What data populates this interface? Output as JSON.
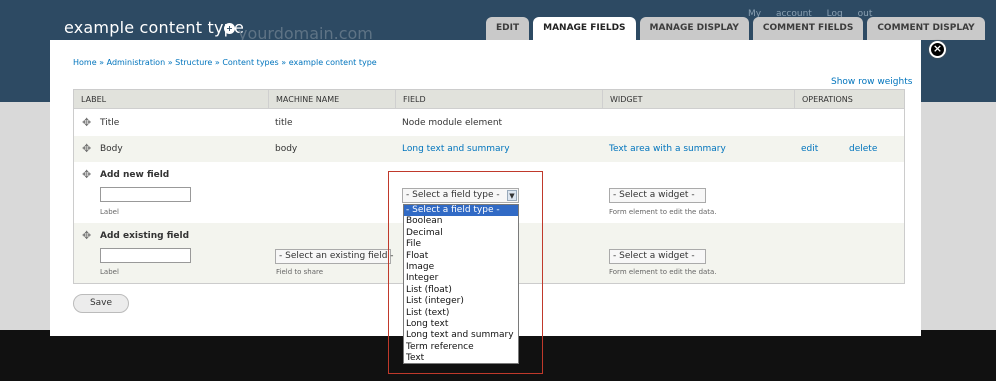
{
  "site": {
    "page_title": "example content type",
    "domain_watermark": "yourdomain.com",
    "account_links": "My account  Log out"
  },
  "tabs": [
    {
      "label": "EDIT",
      "active": false
    },
    {
      "label": "MANAGE FIELDS",
      "active": true
    },
    {
      "label": "MANAGE DISPLAY",
      "active": false
    },
    {
      "label": "COMMENT FIELDS",
      "active": false
    },
    {
      "label": "COMMENT DISPLAY",
      "active": false
    }
  ],
  "overlay": {
    "close_symbol": "×",
    "breadcrumb": "Home » Administration » Structure » Content types » example content type",
    "show_row_weights": "Show row weights",
    "save_label": "Save"
  },
  "table": {
    "headers": [
      "LABEL",
      "MACHINE NAME",
      "FIELD",
      "WIDGET",
      "OPERATIONS"
    ],
    "rows": [
      {
        "label": "Title",
        "machine_name": "title",
        "field": "Node module element",
        "widget": "",
        "edit": "",
        "delete": ""
      },
      {
        "label": "Body",
        "machine_name": "body",
        "field": "Long text and summary",
        "widget": "Text area with a summary",
        "edit": "edit",
        "delete": "delete"
      }
    ],
    "add_new": {
      "title": "Add new field",
      "label_desc": "Label",
      "field_type_select": "- Select a field type -",
      "widget_select": "- Select a widget -",
      "widget_desc": "Form element to edit the data."
    },
    "add_existing": {
      "title": "Add existing field",
      "label_desc": "Label",
      "existing_select": "- Select an existing field -",
      "existing_desc": "Field to share",
      "widget_select": "- Select a widget -",
      "widget_desc": "Form element to edit the data."
    }
  },
  "field_type_options": [
    "- Select a field type -",
    "Boolean",
    "Decimal",
    "File",
    "Float",
    "Image",
    "Integer",
    "List (float)",
    "List (integer)",
    "List (text)",
    "Long text",
    "Long text and summary",
    "Term reference",
    "Text"
  ],
  "selected_option_index": 0,
  "icons": {
    "drag": "drag-handle-icon",
    "close": "close-icon",
    "dropdown_arrow": "chevron-down-icon"
  },
  "colors": {
    "link": "#0074bd",
    "header_bg": "#2d4a63",
    "selected_option": "#316ac5",
    "highlight": "#c0392b"
  }
}
